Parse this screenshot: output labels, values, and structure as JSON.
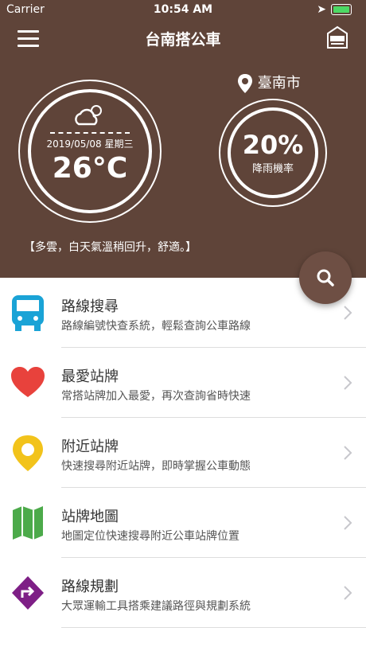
{
  "status": {
    "carrier": "Carrier",
    "time": "10:54 AM"
  },
  "nav": {
    "title": "台南搭公車"
  },
  "weather": {
    "date": "2019/05/08 星期三",
    "temperature": "26°C",
    "location": "臺南市",
    "rain_percent": "20%",
    "rain_label": "降雨機率",
    "description": "【多雲，白天氣溫稍回升，舒適。】"
  },
  "menu": [
    {
      "title": "路線搜尋",
      "subtitle": "路線編號快查系統，輕鬆查詢公車路線",
      "icon": "bus-icon",
      "color": "#1aa3d6"
    },
    {
      "title": "最愛站牌",
      "subtitle": "常搭站牌加入最愛，再次查詢省時快速",
      "icon": "heart-icon",
      "color": "#e8423c"
    },
    {
      "title": "附近站牌",
      "subtitle": "快速搜尋附近站牌，即時掌握公車動態",
      "icon": "location-pin-icon",
      "color": "#f2c31b"
    },
    {
      "title": "站牌地圖",
      "subtitle": "地圖定位快速搜尋附近公車站牌位置",
      "icon": "map-icon",
      "color": "#4caa4a"
    },
    {
      "title": "路線規劃",
      "subtitle": "大眾運輸工具搭乘建議路徑與規劃系統",
      "icon": "route-icon",
      "color": "#7e1f86"
    }
  ]
}
